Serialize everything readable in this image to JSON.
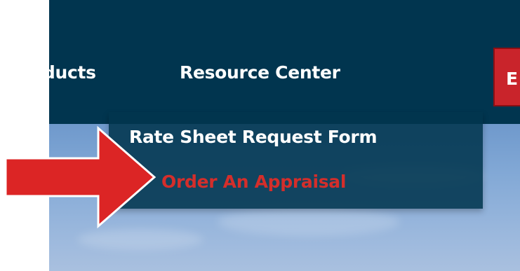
{
  "nav": {
    "items": [
      {
        "label": "oducts"
      },
      {
        "label": "Resource Center"
      }
    ],
    "cta_label": "E"
  },
  "dropdown": {
    "items": [
      {
        "label": "Rate Sheet Request Form"
      },
      {
        "label": "Order An Appraisal"
      }
    ]
  },
  "annotation": {
    "arrow_icon": "arrow-right-icon",
    "arrow_color": "#dc2525"
  },
  "colors": {
    "nav_bg": "#01354f",
    "cta_bg": "#c9242b",
    "highlight_text": "#d42e2b",
    "dropdown_text": "#ffffff"
  }
}
